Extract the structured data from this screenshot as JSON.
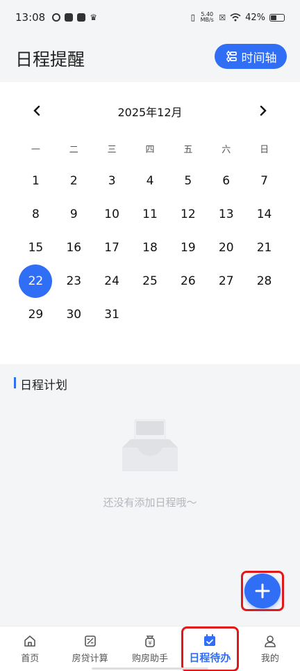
{
  "status_bar": {
    "time": "13:08",
    "speed_top": "5.40",
    "speed_bottom": "MB/s",
    "battery": "42%"
  },
  "header": {
    "title": "日程提醒",
    "timeline_button": "时间轴"
  },
  "calendar": {
    "month_label": "2025年12月",
    "weekdays": [
      "一",
      "二",
      "三",
      "四",
      "五",
      "六",
      "日"
    ],
    "days": [
      "1",
      "2",
      "3",
      "4",
      "5",
      "6",
      "7",
      "8",
      "9",
      "10",
      "11",
      "12",
      "13",
      "14",
      "15",
      "16",
      "17",
      "18",
      "19",
      "20",
      "21",
      "22",
      "23",
      "24",
      "25",
      "26",
      "27",
      "28",
      "29",
      "30",
      "31"
    ],
    "selected_day": "22"
  },
  "plan": {
    "title": "日程计划",
    "empty_text": "还没有添加日程哦～"
  },
  "bottom_nav": {
    "items": [
      {
        "label": "首页",
        "icon": "home-icon"
      },
      {
        "label": "房贷计算",
        "icon": "calculator-icon"
      },
      {
        "label": "购房助手",
        "icon": "yuan-bag-icon"
      },
      {
        "label": "日程待办",
        "icon": "calendar-check-icon",
        "active": true
      },
      {
        "label": "我的",
        "icon": "person-icon"
      }
    ]
  },
  "colors": {
    "accent": "#2f6ef5",
    "highlight_box": "#e21818",
    "empty_text": "#b3b6bc"
  }
}
